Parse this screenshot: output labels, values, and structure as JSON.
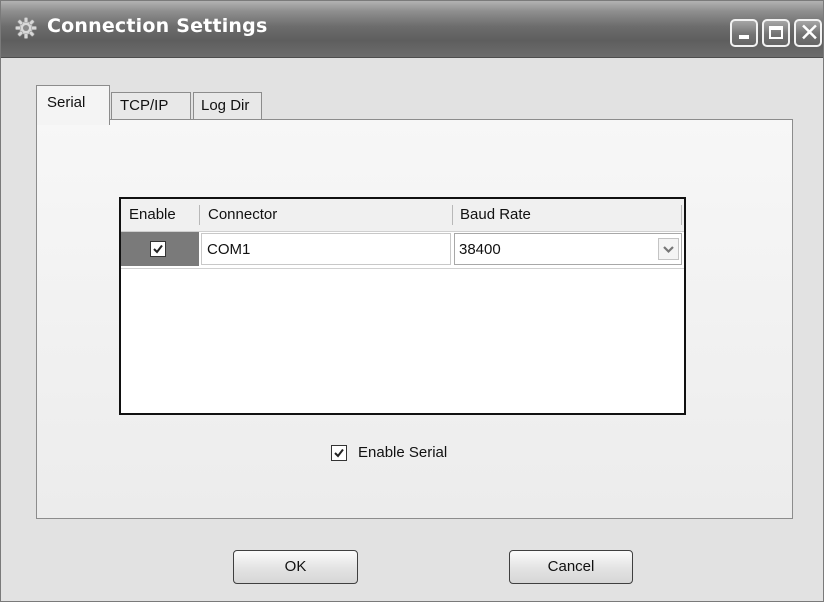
{
  "window": {
    "title": "Connection Settings",
    "icon": "gear-icon",
    "controls": [
      "minimize-icon",
      "maximize-icon",
      "close-icon"
    ]
  },
  "tabs": [
    {
      "label": "Serial",
      "active": true
    },
    {
      "label": "TCP/IP",
      "active": false
    },
    {
      "label": "Log Dir",
      "active": false
    }
  ],
  "grid": {
    "columns": [
      "Enable",
      "Connector",
      "Baud Rate"
    ],
    "rows": [
      {
        "enabled": true,
        "connector": "COM1",
        "baud_rate": "38400"
      }
    ]
  },
  "enable_serial": {
    "label": "Enable Serial",
    "checked": true
  },
  "buttons": {
    "ok": "OK",
    "cancel": "Cancel"
  },
  "colors": {
    "titlebar": "#6d6d6d",
    "selected_cell": "#7a7a7a",
    "window_bg": "#e2e2e2"
  }
}
